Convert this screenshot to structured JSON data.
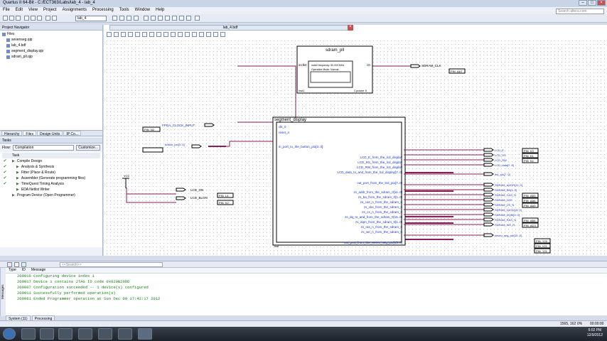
{
  "window": {
    "title": "Quartus II 64-Bit - C:/ECT363/Labs/lab_4 - lab_4"
  },
  "menu": [
    "File",
    "Edit",
    "View",
    "Project",
    "Assignments",
    "Processing",
    "Tools",
    "Window",
    "Help"
  ],
  "search": {
    "placeholder": "Search altera.com"
  },
  "toolbar": {
    "project_combo": "lab_4"
  },
  "navigator": {
    "title": "Project Navigator",
    "root": "Files",
    "files": [
      "sevenseg.qip",
      "lab_4.bdf",
      "segment_display.qip",
      "sdram_pll.qip"
    ],
    "tabs": [
      "Hierarchy",
      "Files",
      "Design Units",
      "IP Co..."
    ]
  },
  "tasks": {
    "title": "Tasks",
    "flow_label": "Flow:",
    "flow_value": "Compilation",
    "customize": "Customize...",
    "header": "Task",
    "items": [
      {
        "label": "Compile Design",
        "checked": true,
        "indent": 1
      },
      {
        "label": "Analysis & Synthesis",
        "checked": true,
        "indent": 2
      },
      {
        "label": "Fitter (Place & Route)",
        "checked": true,
        "indent": 2
      },
      {
        "label": "Assembler (Generate programming files)",
        "checked": true,
        "indent": 2
      },
      {
        "label": "TimeQuest Timing Analysis",
        "checked": true,
        "indent": 2
      },
      {
        "label": "EDA Netlist Writer",
        "checked": false,
        "indent": 2
      },
      {
        "label": "Program Device (Open Programmer)",
        "checked": false,
        "indent": 1
      }
    ]
  },
  "document": {
    "tab": "lab_4.bdf"
  },
  "schematic": {
    "pll": {
      "title": "sdram_pll",
      "port_in": "inclk0",
      "port_out": "c0",
      "info1": "inclk0 frequency: 50.000 MHz",
      "info2": "Operation Mode: Normal",
      "footer_left": "inst1",
      "footer_right": "Cyclone II",
      "output_name": "SDRAM_CLK",
      "pin": "PIN_AA7"
    },
    "seg": {
      "title": "segment_display",
      "inputs": [
        "clk_0",
        "reset_n",
        "in_port_to_the_button_pio[3..0]"
      ],
      "outputs": [
        "LCD_E_from_the_lcd_display",
        "LCD_RS_from_the_lcd_display",
        "LCD_RW_from_the_lcd_display",
        "LCD_data_to_and_from_the_lcd_display[7..0]",
        "out_port_from_the_led_pio[7..0]",
        "zs_addr_from_the_sdram_0[11..0]",
        "zs_ba_from_the_sdram_0[1..0]",
        "zs_cas_n_from_the_sdram_0",
        "zs_cke_from_the_sdram_0",
        "zs_cs_n_from_the_sdram_0",
        "zs_dq_to_and_from_the_sdram_0[15..0]",
        "zs_dqm_from_the_sdram_0[1..0]",
        "zs_ras_n_from_the_sdram_0",
        "zs_we_n_from_the_sdram_0",
        "out_port_from_the_seven_seg_pio[15..0]"
      ],
      "footer": "inst"
    },
    "left_inputs": [
      {
        "name": "FPGA_CLOCK_INPUT",
        "pin": "PIN_N2"
      },
      {
        "name": "button_pio[3..0]",
        "pin": ""
      }
    ],
    "vcc": "VCC",
    "lcd_outputs": [
      {
        "name": "LCD_ON",
        "pin": "PIN_L4"
      },
      {
        "name": "LCD_BLON",
        "pin": "PIN_K2"
      }
    ],
    "right_outputs": [
      {
        "name": "LCD_E",
        "pin": "PIN_K3"
      },
      {
        "name": "LCD_RS",
        "pin": "PIN_K1"
      },
      {
        "name": "LCD_RW",
        "pin": "PIN_K4"
      },
      {
        "name": "LCD_data[7..0]",
        "pin": ""
      },
      {
        "name": "led_pio[7..0]",
        "pin": ""
      },
      {
        "name": "SDRAM_ADDR[11..0]",
        "pin": ""
      },
      {
        "name": "SDRAM_BA[1..0]",
        "pin": ""
      },
      {
        "name": "SDRAM_CAS_N",
        "pin": "PIN_AB3"
      },
      {
        "name": "SDRAM_CKE",
        "pin": "PIN_AA6"
      },
      {
        "name": "SDRAM_CS_N",
        "pin": "PIN_AA3"
      },
      {
        "name": "SDRAM_DATA[15..0]",
        "pin": ""
      },
      {
        "name": "SDRAM_DQM[1..0]",
        "pin": ""
      },
      {
        "name": "SDRAM_RAS_N",
        "pin": "PIN_AB4"
      },
      {
        "name": "SDRAM_WE_N",
        "pin": "PIN_AD3"
      },
      {
        "name": "seven_seg_pio[15..0]",
        "pin": ""
      }
    ],
    "bottom_pins": [
      "PIN_Y20",
      "PIN_V21",
      "PIN_Y21"
    ]
  },
  "messages": {
    "filter_placeholder": "<<Search>>",
    "columns": [
      "Type",
      "ID",
      "Message"
    ],
    "lines": [
      "209016 Configuring device index 1",
      "209017 Device 1 contains JTAG ID code 0x020B20DD",
      "209007 Configuration succeeded -- 1 device(s) configured",
      "209011 Successfully performed operation(s)",
      "209061 Ended Programmer operation at Sun Dec 09 17:42:17 2012"
    ],
    "side_label": "Messages",
    "tabs": [
      "System (11)",
      "Processing"
    ]
  },
  "status": {
    "coords": "1565, 162",
    "zoom": "0%",
    "time": "00:00:00"
  },
  "clock": {
    "time": "6:02 PM",
    "date": "12/9/2012"
  }
}
